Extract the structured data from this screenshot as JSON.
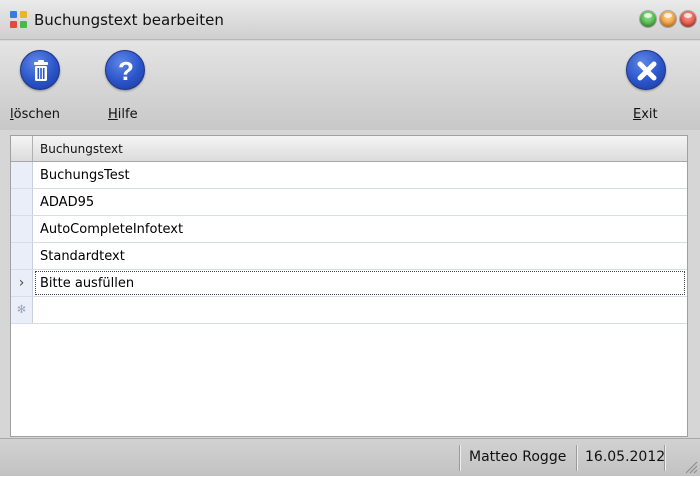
{
  "window": {
    "title": "Buchungstext bearbeiten"
  },
  "toolbar": {
    "delete_label_prefix": "l",
    "delete_label_rest": "öschen",
    "help_label_prefix": "H",
    "help_label_rest": "ilfe",
    "exit_label_prefix": "E",
    "exit_label_rest": "xit"
  },
  "grid": {
    "column_header": "Buchungstext",
    "rows": [
      "BuchungsTest",
      "ADAD95",
      "AutoCompleteInfotext",
      "Standardtext",
      "Bitte ausfüllen"
    ],
    "current_row_marker": "›",
    "new_row_marker": "✻"
  },
  "status": {
    "user": "Matteo Rogge",
    "date": "16.05.2012"
  },
  "colors": {
    "accent": "#2b54c9",
    "min": "#3fbf35",
    "max": "#f39a1e",
    "close": "#e2473a"
  }
}
